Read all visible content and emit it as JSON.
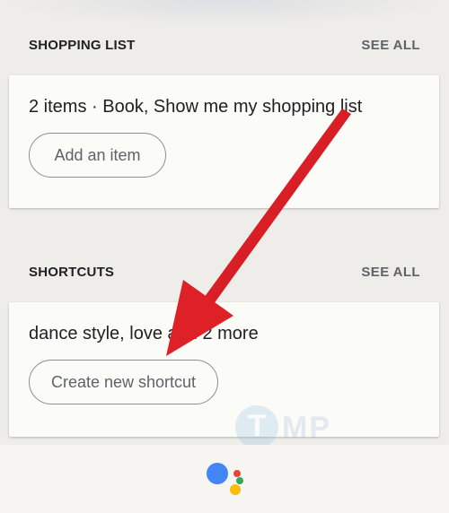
{
  "shopping_list": {
    "title": "SHOPPING LIST",
    "see_all": "SEE ALL",
    "summary": "2 items · Book, Show me my shopping list",
    "add_item_label": "Add an item"
  },
  "shortcuts": {
    "title": "SHORTCUTS",
    "see_all": "SEE ALL",
    "summary": "dance style, love and 2 more",
    "create_label": "Create new shortcut"
  },
  "watermark": {
    "letter": "T",
    "text": "MP"
  },
  "colors": {
    "arrow": "#dd2127",
    "assistant_blue": "#4285f4",
    "assistant_red": "#ea4335",
    "assistant_yellow": "#fbbc05",
    "assistant_green": "#34a853"
  },
  "icons": {
    "assistant": "google-assistant-icon",
    "annotation": "red-arrow-annotation"
  }
}
